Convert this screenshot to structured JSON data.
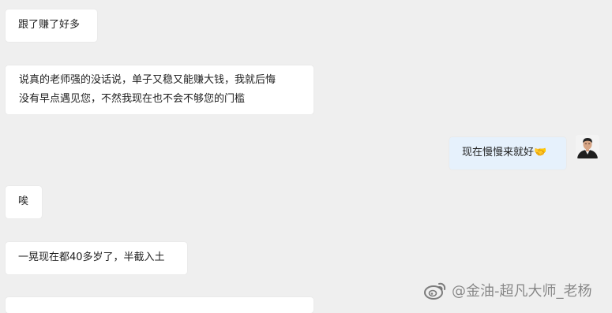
{
  "messages": [
    {
      "direction": "incoming",
      "lines": [
        "跟了赚了好多"
      ]
    },
    {
      "direction": "incoming",
      "lines": [
        "说真的老师强的没话说，单子又稳又能赚大钱，我就后悔",
        "没有早点遇见您，不然我现在也不会不够您的门槛"
      ]
    },
    {
      "direction": "outgoing",
      "lines": [
        "现在慢慢来就好🤝"
      ]
    },
    {
      "direction": "incoming",
      "lines": [
        "唉"
      ]
    },
    {
      "direction": "incoming",
      "lines": [
        "一晃现在都40多岁了，半截入土"
      ]
    }
  ],
  "watermark": {
    "text": "@金油-超凡大师_老杨",
    "icon": "weibo-icon"
  },
  "avatar": {
    "icon": "user-avatar"
  }
}
